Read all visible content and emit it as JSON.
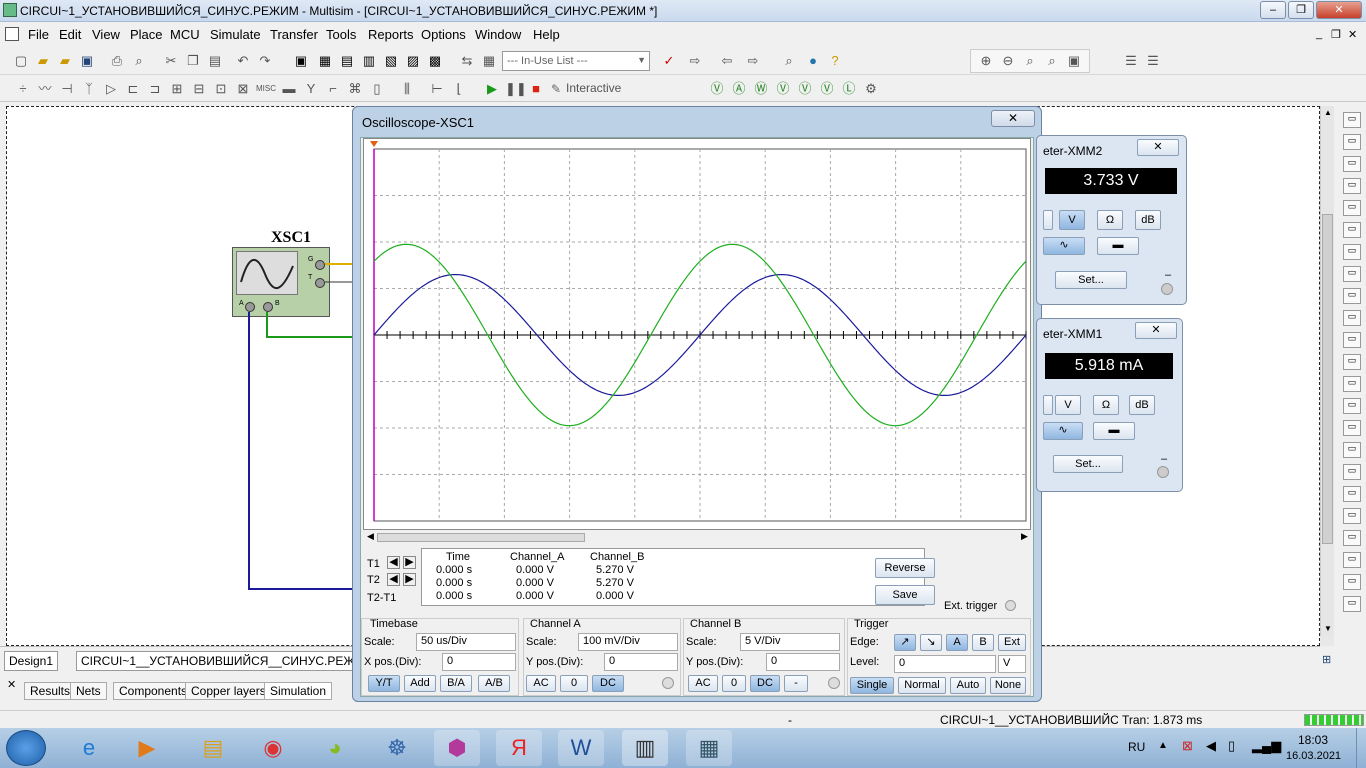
{
  "window": {
    "title": "CIRCUI~1_УСТАНОВИВШИЙСЯ_СИНУС.РЕЖИМ - Multisim - [CIRCUI~1_УСТАНОВИВШИЙСЯ_СИНУС.РЕЖИМ *]"
  },
  "menu": [
    "File",
    "Edit",
    "View",
    "Place",
    "MCU",
    "Simulate",
    "Transfer",
    "Tools",
    "Reports",
    "Options",
    "Window",
    "Help"
  ],
  "toolbar": {
    "inuse_list": "--- In-Use List ---",
    "interactive": "Interactive"
  },
  "schematic": {
    "scope_label": "XSC1",
    "scope_pins": {
      "a": "A",
      "b": "B",
      "g": "G",
      "t": "T"
    }
  },
  "tabs": {
    "design": "Design1",
    "file": "CIRCUI~1__УСТАНОВИВШИЙСЯ__СИНУС.РЕЖ"
  },
  "bottom_tabs": [
    "Results",
    "Nets",
    "Components",
    "Copper layers",
    "Simulation"
  ],
  "status": {
    "dash": "-",
    "file": "CIRCUI~1__УСТАНОВИВШИЙСЯ_",
    "tran": "Tran: 1.873 ms"
  },
  "oscilloscope": {
    "title": "Oscilloscope-XSC1",
    "close": "✕",
    "readout_headers": [
      "Time",
      "Channel_A",
      "Channel_B"
    ],
    "rows": [
      {
        "label": "T1",
        "time": "0.000 s",
        "a": "0.000 V",
        "b": "5.270 V"
      },
      {
        "label": "T2",
        "time": "0.000 s",
        "a": "0.000 V",
        "b": "5.270 V"
      },
      {
        "label": "T2-T1",
        "time": "0.000 s",
        "a": "0.000 V",
        "b": "0.000 V"
      }
    ],
    "reverse": "Reverse",
    "save": "Save",
    "ext_trigger": "Ext. trigger",
    "timebase": {
      "title": "Timebase",
      "scale_label": "Scale:",
      "scale": "50 us/Div",
      "xpos_label": "X pos.(Div):",
      "xpos": "0",
      "buttons": [
        "Y/T",
        "Add",
        "B/A",
        "A/B"
      ]
    },
    "channel_a": {
      "title": "Channel A",
      "scale_label": "Scale:",
      "scale": "100 mV/Div",
      "ypos_label": "Y pos.(Div):",
      "ypos": "0",
      "buttons": [
        "AC",
        "0",
        "DC"
      ]
    },
    "channel_b": {
      "title": "Channel B",
      "scale_label": "Scale:",
      "scale": "5  V/Div",
      "ypos_label": "Y pos.(Div):",
      "ypos": "0",
      "buttons": [
        "AC",
        "0",
        "DC",
        "-"
      ]
    },
    "trigger": {
      "title": "Trigger",
      "edge_label": "Edge:",
      "edge_buttons": [
        "↗",
        "↘",
        "A",
        "B",
        "Ext"
      ],
      "level_label": "Level:",
      "level": "0",
      "unit": "V",
      "modes": [
        "Single",
        "Normal",
        "Auto",
        "None"
      ]
    }
  },
  "chart_data": {
    "type": "line",
    "x_unit": "us",
    "x_range": [
      0,
      500
    ],
    "series": [
      {
        "color": "#1a1a9a",
        "amplitude_div": 1.3,
        "phase": "sine",
        "period_div": 5
      },
      {
        "color": "#1fae1f",
        "amplitude_div": 1.95,
        "phase": "phase-lead",
        "period_div": 5
      }
    ],
    "grid": true
  },
  "mm2": {
    "title": "eter-XMM2",
    "reading": "3.733 V",
    "buttons": [
      "V",
      "Ω",
      "dB"
    ],
    "set": "Set...",
    "minus": "–"
  },
  "mm1": {
    "title": "eter-XMM1",
    "reading": "5.918 mA",
    "buttons": [
      "V",
      "Ω",
      "dB"
    ],
    "set": "Set...",
    "minus": "–"
  },
  "taskbar": {
    "lang": "RU",
    "time": "18:03",
    "date": "16.03.2021"
  }
}
